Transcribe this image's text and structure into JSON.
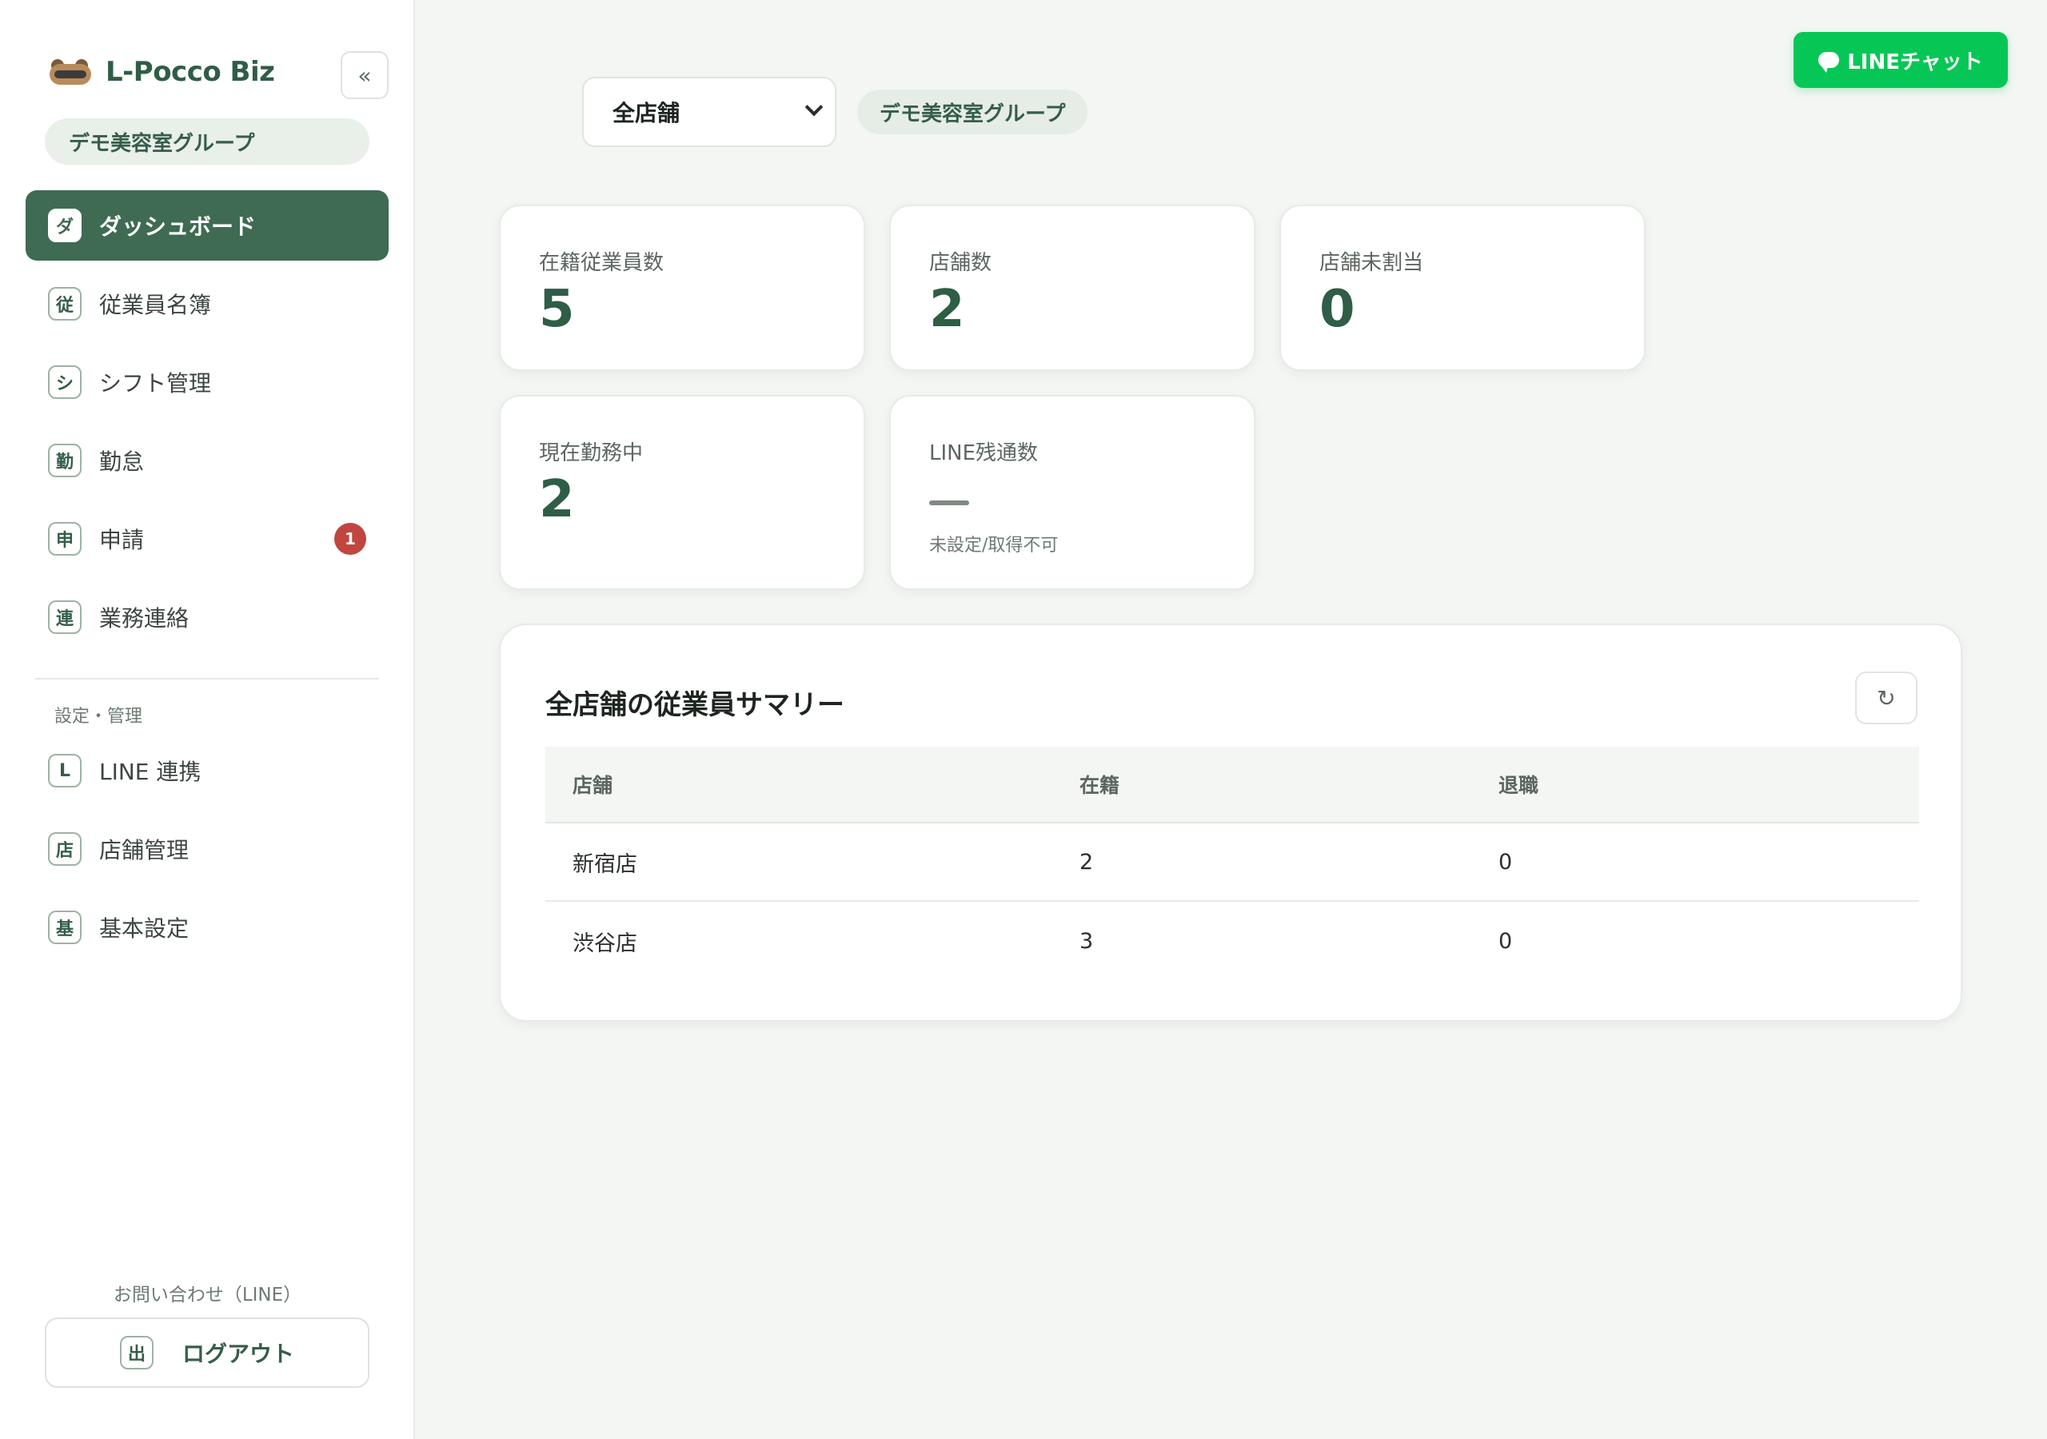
{
  "brand": {
    "name": "L-Pocco Biz",
    "collapse_label": "«"
  },
  "group_name": "デモ美容室グループ",
  "sidebar": {
    "items": [
      {
        "icon": "ダ",
        "label": "ダッシュボード"
      },
      {
        "icon": "従",
        "label": "従業員名簿"
      },
      {
        "icon": "シ",
        "label": "シフト管理"
      },
      {
        "icon": "勤",
        "label": "勤怠"
      },
      {
        "icon": "申",
        "label": "申請",
        "badge": "1"
      },
      {
        "icon": "連",
        "label": "業務連絡"
      }
    ],
    "settings_label": "設定・管理",
    "settings_items": [
      {
        "icon": "L",
        "label": "LINE 連携"
      },
      {
        "icon": "店",
        "label": "店舗管理"
      },
      {
        "icon": "基",
        "label": "基本設定"
      }
    ],
    "contact_label": "お問い合わせ（LINE）",
    "logout": {
      "icon": "出",
      "label": "ログアウト"
    }
  },
  "header": {
    "store_select_value": "全店舗",
    "group_chip": "デモ美容室グループ",
    "line_chat_label": "LINEチャット"
  },
  "stats": [
    {
      "label": "在籍従業員数",
      "value": "5"
    },
    {
      "label": "店舗数",
      "value": "2"
    },
    {
      "label": "店舗未割当",
      "value": "0"
    },
    {
      "label": "現在勤務中",
      "value": "2"
    },
    {
      "label": "LINE残通数",
      "value": "—",
      "sub": "未設定/取得不可"
    }
  ],
  "summary": {
    "title": "全店舗の従業員サマリー",
    "refresh_label": "↻",
    "columns": [
      "店舗",
      "在籍",
      "退職"
    ],
    "rows": [
      [
        "新宿店",
        "2",
        "0"
      ],
      [
        "渋谷店",
        "3",
        "0"
      ]
    ]
  },
  "colors": {
    "accent": "#3e6b52",
    "line_green": "#06c755",
    "badge_red": "#c0463f"
  }
}
